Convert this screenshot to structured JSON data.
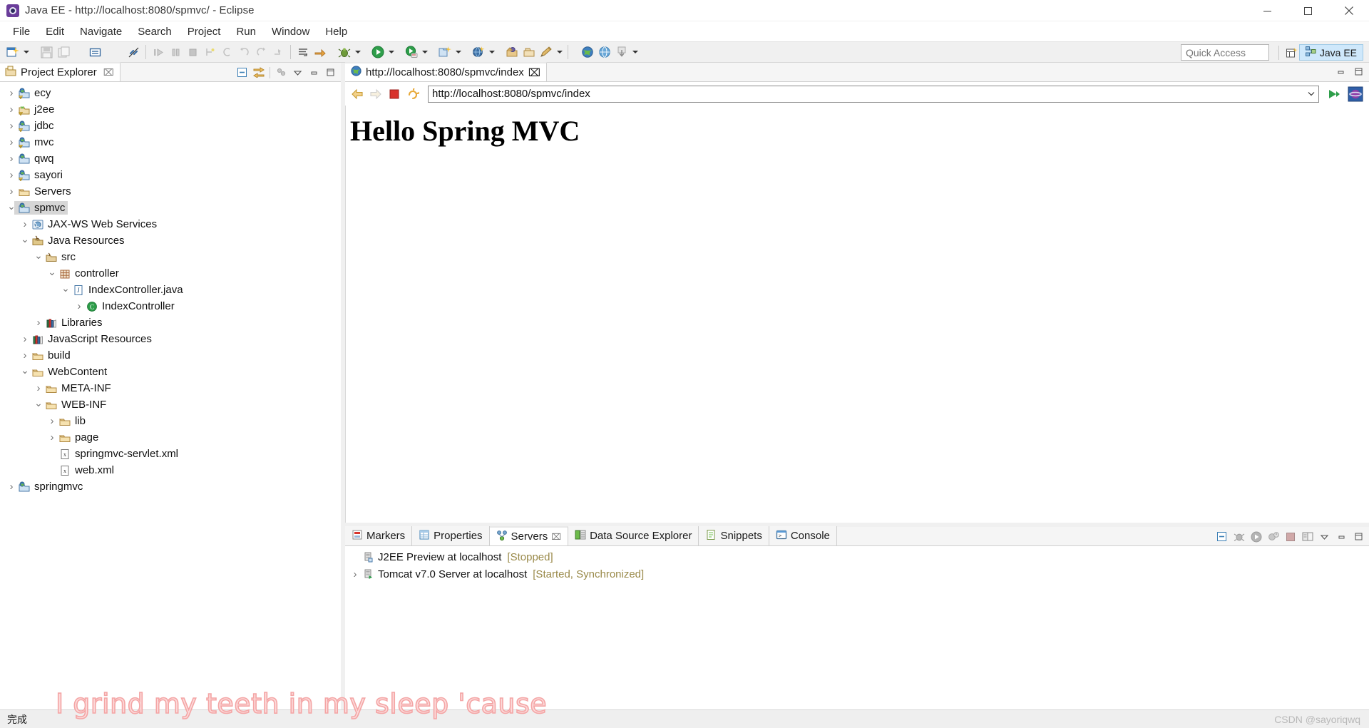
{
  "window": {
    "title": "Java EE - http://localhost:8080/spmvc/ - Eclipse",
    "icon": "eclipse-icon",
    "minimize_label": "─",
    "maximize_label": "□",
    "close_label": "✕"
  },
  "menu": {
    "items": [
      {
        "label": "File",
        "name": "menu-file"
      },
      {
        "label": "Edit",
        "name": "menu-edit"
      },
      {
        "label": "Navigate",
        "name": "menu-navigate"
      },
      {
        "label": "Search",
        "name": "menu-search"
      },
      {
        "label": "Project",
        "name": "menu-project"
      },
      {
        "label": "Run",
        "name": "menu-run"
      },
      {
        "label": "Window",
        "name": "menu-window"
      },
      {
        "label": "Help",
        "name": "menu-help"
      }
    ]
  },
  "toolbar": {
    "quick_access_placeholder": "Quick Access",
    "perspective_label": "Java EE",
    "icons": [
      "new-wizard-icon",
      "save-icon",
      "save-all-icon",
      "print-icon",
      "link-break-icon",
      "run-last-tool-icon",
      "step-icon",
      "terminate-icon",
      "new-class-icon",
      "undo-icon",
      "redo-icon",
      "forward-icon",
      "open-task-icon",
      "skip-breakpoints-icon",
      "debug-icon",
      "run-icon",
      "run-server-icon",
      "new-java-project-icon",
      "new-ee-project-icon",
      "new-package-icon",
      "new-folder-icon",
      "edit-icon",
      "open-web-browser-icon",
      "open-browser-alt-icon",
      "import-icon"
    ]
  },
  "explorer": {
    "tab_label": "Project Explorer",
    "tab_icon": "project-explorer-icon",
    "close_label": "⌧",
    "tools": [
      "collapse-all-icon",
      "link-with-editor-icon",
      "view-menu-dots-icon",
      "view-menu-icon",
      "minimize-icon",
      "maximize-icon"
    ],
    "tree": [
      {
        "label": "ecy",
        "depth": 0,
        "twisty": "closed",
        "icon": "dynamic-web-project-warn-icon",
        "selected": false
      },
      {
        "label": "j2ee",
        "depth": 0,
        "twisty": "closed",
        "icon": "project-warn-icon",
        "selected": false
      },
      {
        "label": "jdbc",
        "depth": 0,
        "twisty": "closed",
        "icon": "dynamic-web-project-warn-icon",
        "selected": false
      },
      {
        "label": "mvc",
        "depth": 0,
        "twisty": "closed",
        "icon": "dynamic-web-project-warn-icon",
        "selected": false
      },
      {
        "label": "qwq",
        "depth": 0,
        "twisty": "closed",
        "icon": "dynamic-web-project-icon",
        "selected": false
      },
      {
        "label": "sayori",
        "depth": 0,
        "twisty": "closed",
        "icon": "dynamic-web-project-warn-icon",
        "selected": false
      },
      {
        "label": "Servers",
        "depth": 0,
        "twisty": "closed",
        "icon": "folder-icon",
        "selected": false
      },
      {
        "label": "spmvc",
        "depth": 0,
        "twisty": "open",
        "icon": "dynamic-web-project-icon",
        "selected": true
      },
      {
        "label": "JAX-WS Web Services",
        "depth": 1,
        "twisty": "closed",
        "icon": "jaxws-icon",
        "selected": false
      },
      {
        "label": "Java Resources",
        "depth": 1,
        "twisty": "open",
        "icon": "java-resources-icon",
        "selected": false
      },
      {
        "label": "src",
        "depth": 2,
        "twisty": "open",
        "icon": "source-folder-icon",
        "selected": false
      },
      {
        "label": "controller",
        "depth": 3,
        "twisty": "open",
        "icon": "package-icon",
        "selected": false
      },
      {
        "label": "IndexController.java",
        "depth": 4,
        "twisty": "open",
        "icon": "java-file-icon",
        "selected": false
      },
      {
        "label": "IndexController",
        "depth": 5,
        "twisty": "closed",
        "icon": "java-class-icon",
        "selected": false
      },
      {
        "label": "Libraries",
        "depth": 2,
        "twisty": "closed",
        "icon": "libraries-icon",
        "selected": false
      },
      {
        "label": "JavaScript Resources",
        "depth": 1,
        "twisty": "closed",
        "icon": "libraries-icon",
        "selected": false
      },
      {
        "label": "build",
        "depth": 1,
        "twisty": "closed",
        "icon": "folder-icon",
        "selected": false
      },
      {
        "label": "WebContent",
        "depth": 1,
        "twisty": "open",
        "icon": "folder-icon",
        "selected": false
      },
      {
        "label": "META-INF",
        "depth": 2,
        "twisty": "closed",
        "icon": "folder-icon",
        "selected": false
      },
      {
        "label": "WEB-INF",
        "depth": 2,
        "twisty": "open",
        "icon": "folder-icon",
        "selected": false
      },
      {
        "label": "lib",
        "depth": 3,
        "twisty": "closed",
        "icon": "folder-icon",
        "selected": false
      },
      {
        "label": "page",
        "depth": 3,
        "twisty": "closed",
        "icon": "folder-icon",
        "selected": false
      },
      {
        "label": "springmvc-servlet.xml",
        "depth": 3,
        "twisty": "empty",
        "icon": "xml-file-icon",
        "selected": false
      },
      {
        "label": "web.xml",
        "depth": 3,
        "twisty": "empty",
        "icon": "xml-file-icon",
        "selected": false
      },
      {
        "label": "springmvc",
        "depth": 0,
        "twisty": "closed",
        "icon": "dynamic-web-project-icon",
        "selected": false
      }
    ]
  },
  "editor": {
    "tab_label": "http://localhost:8080/spmvc/index",
    "tab_icon": "web-browser-icon",
    "close_label": "⌧",
    "browser": {
      "back_icon": "back-arrow-icon",
      "forward_icon": "forward-arrow-icon",
      "stop_icon": "stop-icon",
      "refresh_icon": "refresh-icon",
      "url": "http://localhost:8080/spmvc/index",
      "go_icon": "go-play-icon",
      "open_external_icon": "open-external-browser-icon"
    },
    "page": {
      "heading": "Hello Spring MVC"
    }
  },
  "bottom_panel": {
    "tabs": [
      {
        "label": "Markers",
        "icon": "markers-icon",
        "active": false,
        "closeable": false
      },
      {
        "label": "Properties",
        "icon": "properties-icon",
        "active": false,
        "closeable": false
      },
      {
        "label": "Servers",
        "icon": "servers-icon",
        "active": true,
        "closeable": true
      },
      {
        "label": "Data Source Explorer",
        "icon": "datasource-icon",
        "active": false,
        "closeable": false
      },
      {
        "label": "Snippets",
        "icon": "snippets-icon",
        "active": false,
        "closeable": false
      },
      {
        "label": "Console",
        "icon": "console-icon",
        "active": false,
        "closeable": false
      }
    ],
    "close_label": "⌧",
    "tools": [
      "collapse-all-icon",
      "debug-server-icon",
      "start-server-icon",
      "profile-server-icon",
      "stop-server-icon",
      "publish-icon",
      "view-menu-icon",
      "minimize-icon",
      "maximize-icon"
    ],
    "servers": [
      {
        "name": "J2EE Preview at localhost",
        "status": "[Stopped]",
        "twisty": "empty",
        "icon": "server-stopped-icon"
      },
      {
        "name": "Tomcat v7.0 Server at localhost",
        "status": "[Started, Synchronized]",
        "twisty": "closed",
        "icon": "server-started-icon"
      }
    ]
  },
  "statusbar": {
    "left_text": "完成",
    "right_text": "CSDN @sayoriqwq"
  },
  "overlay": {
    "lyric_text": "I grind my teeth in my sleep 'cause",
    "lyric_color": "#fcdada",
    "lyric_outline": "#f4a5a5"
  }
}
